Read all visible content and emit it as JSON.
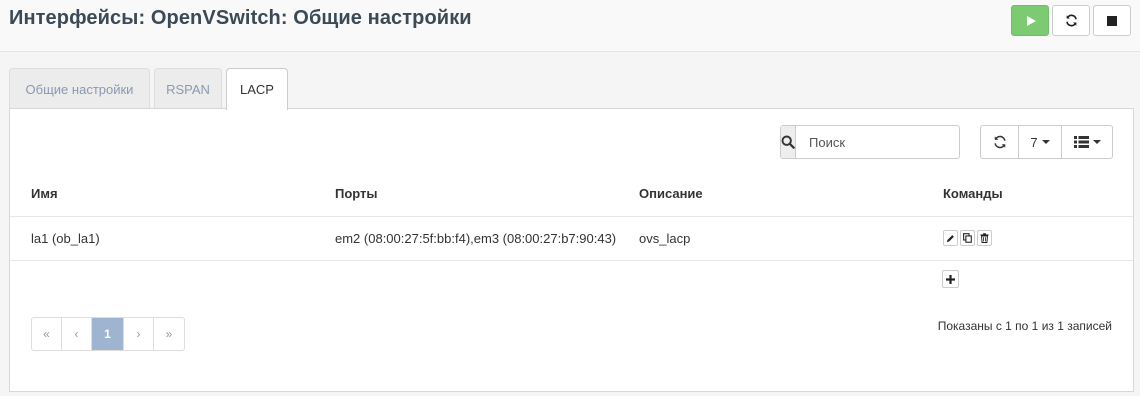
{
  "header": {
    "title": "Интерфейсы: OpenVSwitch: Общие настройки",
    "buttons": [
      {
        "name": "start-button",
        "icon": "play-icon",
        "color": "#7ccb72"
      },
      {
        "name": "reload-button",
        "icon": "refresh-icon"
      },
      {
        "name": "stop-button",
        "icon": "stop-icon"
      }
    ]
  },
  "tabs": [
    {
      "label": "Общие настройки",
      "active": false
    },
    {
      "label": "RSPAN",
      "active": false
    },
    {
      "label": "LACP",
      "active": true
    }
  ],
  "toolbar": {
    "search_placeholder": "Поиск",
    "search_value": "",
    "page_size": "7"
  },
  "table": {
    "columns": [
      "Имя",
      "Порты",
      "Описание",
      "Команды"
    ],
    "rows": [
      {
        "name": "la1 (ob_la1)",
        "ports": "em2 (08:00:27:5f:bb:f4),em3 (08:00:27:b7:90:43)",
        "description": "ovs_lacp",
        "commands": [
          "edit-icon",
          "copy-icon",
          "trash-icon"
        ]
      }
    ]
  },
  "pagination": {
    "first": "«",
    "prev": "‹",
    "current": "1",
    "next": "›",
    "last": "»",
    "info": "Показаны с 1 по 1 из 1 записей"
  },
  "colors": {
    "accent_green": "#7ccb72",
    "pager_active": "#9fb4cf",
    "title": "#3b4a56"
  }
}
